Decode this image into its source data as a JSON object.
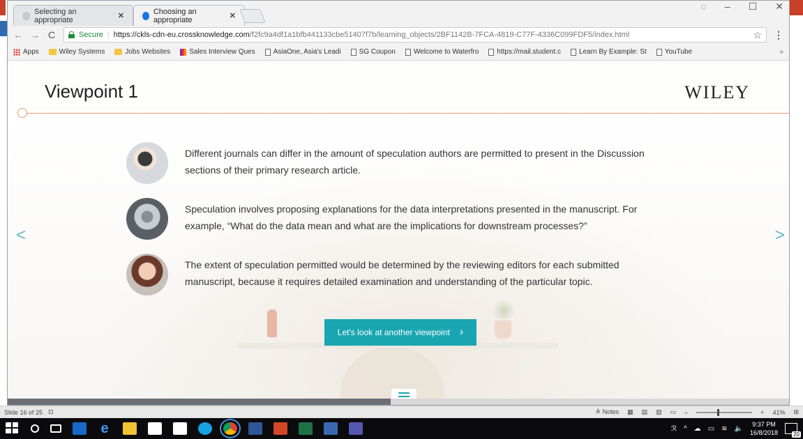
{
  "browser": {
    "tabs": [
      {
        "title": "Selecting an appropriate",
        "active": false
      },
      {
        "title": "Choosing an appropriate",
        "active": true
      }
    ],
    "address": {
      "secure_label": "Secure",
      "host": "https://ckls-cdn-eu.crossknowledge.com",
      "path": "/f2fc9a4df1a1bfb441133cbe51407f7b/learning_objects/2BF1142B-7FCA-4819-C77F-4336C099FDF5/index.html"
    },
    "bookmarks": [
      {
        "label": "Apps",
        "icon": "apps-icon"
      },
      {
        "label": "Wiley Systems",
        "icon": "folder-icon"
      },
      {
        "label": "Jobs Websites",
        "icon": "folder-icon"
      },
      {
        "label": "Sales Interview Ques",
        "icon": "bar-icon"
      },
      {
        "label": "AsiaOne, Asia's Leadi",
        "icon": "page-icon"
      },
      {
        "label": "SG Coupon",
        "icon": "page-icon"
      },
      {
        "label": "Welcome to Waterfro",
        "icon": "page-icon"
      },
      {
        "label": "https://mail.student.c",
        "icon": "page-icon"
      },
      {
        "label": "Learn By Example: St",
        "icon": "page-icon"
      },
      {
        "label": "YouTube",
        "icon": "page-icon"
      }
    ],
    "bookmarks_more": "»"
  },
  "page": {
    "title": "Viewpoint 1",
    "logo": "WILEY",
    "points": [
      {
        "text": "Different journals can differ in the amount of speculation authors are permitted to present in the Discussion sections of their primary research article."
      },
      {
        "text": "Speculation involves proposing explanations for the data interpretations presented in the manuscript. For example, “What do the data mean and what are the implications for downstream processes?”"
      },
      {
        "text": "The extent of speculation permitted would be determined by the reviewing editors for each submitted manuscript, because it requires detailed examination and understanding of the particular topic."
      }
    ],
    "cta_label": "Let's look at another viewpoint",
    "progress_fraction": 0.49
  },
  "ppt_status": {
    "slide_label": "Slide 16 of 25",
    "notes_label": "Notes",
    "zoom_label": "41%"
  },
  "taskbar": {
    "time": "9:37 PM",
    "date": "16/8/2018",
    "notifications": "20"
  },
  "colors": {
    "accent": "#1aa6b0",
    "rule": "#e59a6a",
    "secure": "#1e8e3e"
  }
}
